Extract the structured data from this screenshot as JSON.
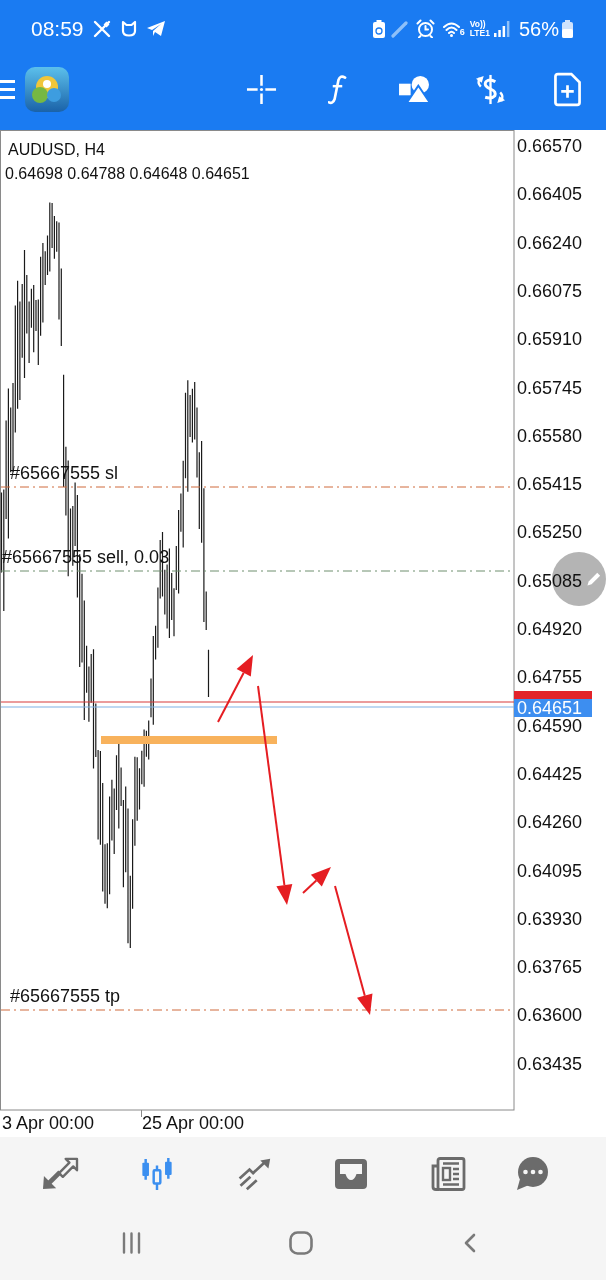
{
  "status_bar": {
    "time": "08:59",
    "wifi_band": "6",
    "volte_top": "Vo))",
    "volte_bottom": "LTE1",
    "battery": "56%"
  },
  "chart": {
    "symbol": "AUDUSD, H4",
    "ohlc": "0.64698 0.64788 0.64648 0.64651",
    "order_lines": [
      {
        "kind": "sl",
        "label": "#65667555 sl"
      },
      {
        "kind": "entry",
        "label": "#65667555 sell, 0.03"
      },
      {
        "kind": "tp",
        "label": "#65667555 tp"
      }
    ],
    "price_axis": [
      "0.66570",
      "0.66405",
      "0.66240",
      "0.66075",
      "0.65910",
      "0.65745",
      "0.65580",
      "0.65415",
      "0.65250",
      "0.65085",
      "0.64920",
      "0.64755",
      "0.64590",
      "0.64425",
      "0.64260",
      "0.64095",
      "0.63930",
      "0.63765",
      "0.63600",
      "0.63435"
    ],
    "bid_price": "0.64651",
    "time_axis": [
      "3 Apr 00:00",
      "25 Apr 00:00"
    ]
  },
  "bottom_nav": [
    {
      "selected": false
    },
    {
      "selected": true
    },
    {
      "selected": false
    },
    {
      "selected": false
    },
    {
      "selected": false
    },
    {
      "selected": false
    }
  ]
}
